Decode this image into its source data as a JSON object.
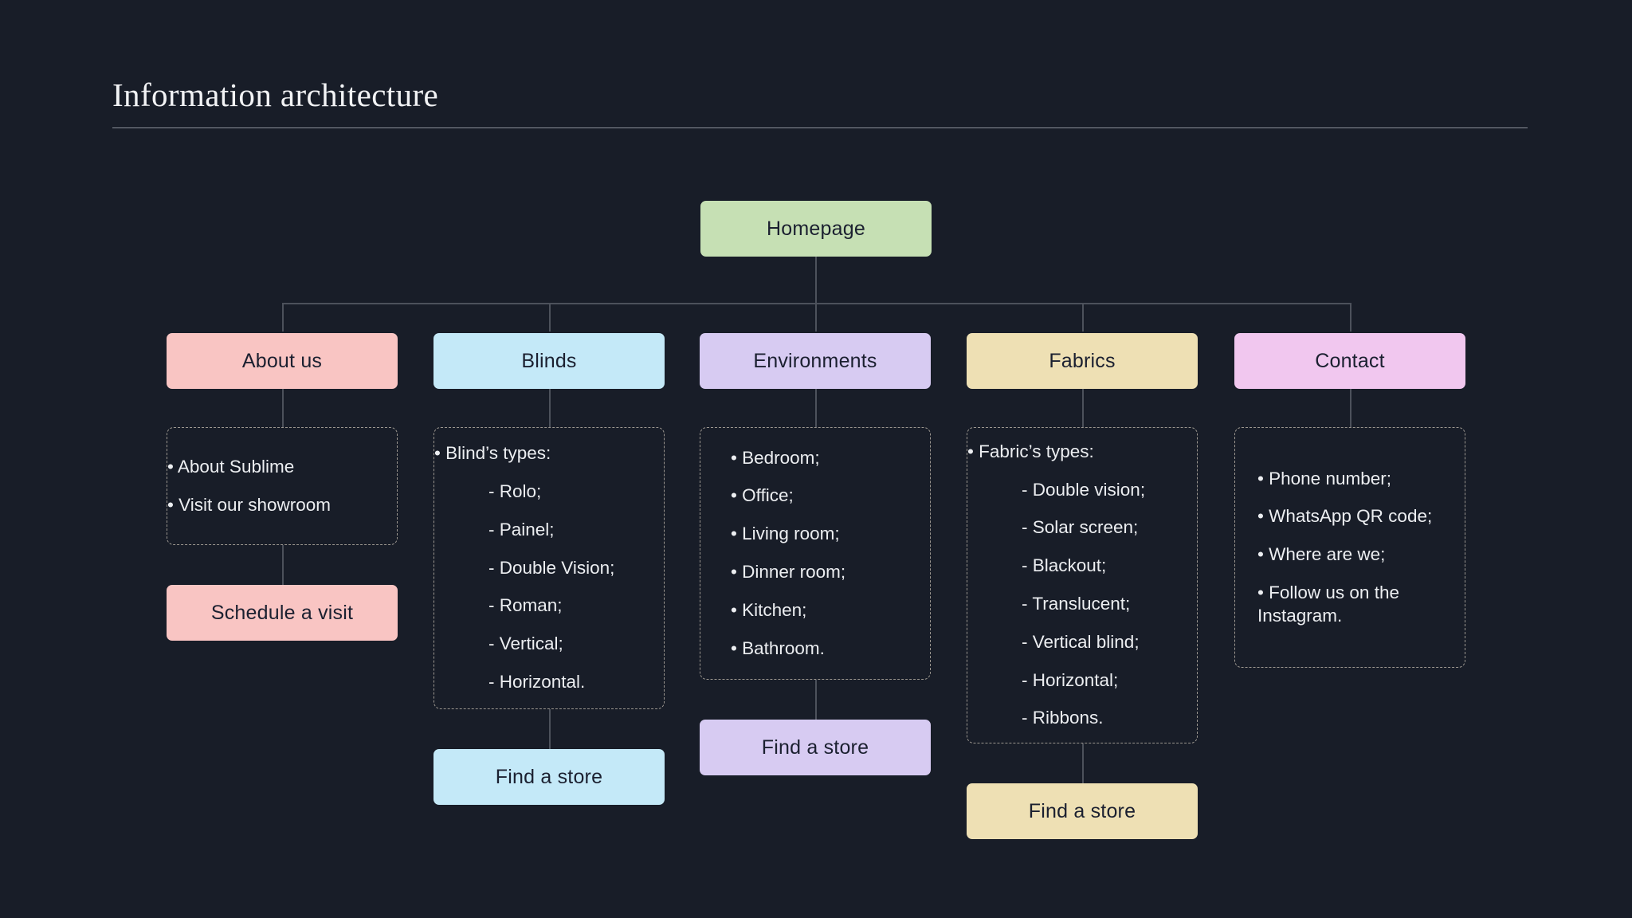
{
  "header": {
    "title": "Information architecture"
  },
  "colors": {
    "background": "#181d28",
    "connector": "#4c515b",
    "dashed_border": "#9b968f",
    "title_text": "#f2f3f5",
    "body_text": "#eceef1",
    "node_text": "#1b2030",
    "green": "#c6e0b4",
    "pink": "#f9c5c3",
    "blue": "#c4e9f8",
    "purple": "#d7cbf2",
    "tan": "#eee0b4",
    "magenta": "#f1c7ef"
  },
  "diagram": {
    "root": {
      "label": "Homepage",
      "color": "#c6e0b4"
    },
    "branches": [
      {
        "id": "about-us",
        "label": "About us",
        "color": "#f9c5c3",
        "details": [
          {
            "text": "• About Sublime",
            "level": 0
          },
          {
            "text": "• Visit our showroom",
            "level": 0
          }
        ],
        "cta": {
          "label": "Schedule a visit",
          "color": "#f9c5c3"
        }
      },
      {
        "id": "blinds",
        "label": "Blinds",
        "color": "#c4e9f8",
        "details": [
          {
            "text": "• Blind’s types:",
            "level": 0
          },
          {
            "text": "- Rolo;",
            "level": 1
          },
          {
            "text": "- Painel;",
            "level": 1
          },
          {
            "text": "- Double Vision;",
            "level": 1
          },
          {
            "text": "- Roman;",
            "level": 1
          },
          {
            "text": "- Vertical;",
            "level": 1
          },
          {
            "text": "- Horizontal.",
            "level": 1
          }
        ],
        "cta": {
          "label": "Find a store",
          "color": "#c4e9f8"
        }
      },
      {
        "id": "environments",
        "label": "Environments",
        "color": "#d7cbf2",
        "details": [
          {
            "text": "• Bedroom;",
            "level": 0
          },
          {
            "text": "• Office;",
            "level": 0
          },
          {
            "text": "• Living room;",
            "level": 0
          },
          {
            "text": "• Dinner room;",
            "level": 0
          },
          {
            "text": "• Kitchen;",
            "level": 0
          },
          {
            "text": "• Bathroom.",
            "level": 0
          }
        ],
        "cta": {
          "label": "Find a store",
          "color": "#d7cbf2"
        }
      },
      {
        "id": "fabrics",
        "label": "Fabrics",
        "color": "#eee0b4",
        "details": [
          {
            "text": "• Fabric’s types:",
            "level": 0
          },
          {
            "text": "- Double vision;",
            "level": 1
          },
          {
            "text": "- Solar screen;",
            "level": 1
          },
          {
            "text": "- Blackout;",
            "level": 1
          },
          {
            "text": "- Translucent;",
            "level": 1
          },
          {
            "text": "- Vertical blind;",
            "level": 1
          },
          {
            "text": "- Horizontal;",
            "level": 1
          },
          {
            "text": "- Ribbons.",
            "level": 1
          }
        ],
        "cta": {
          "label": "Find a store",
          "color": "#eee0b4"
        }
      },
      {
        "id": "contact",
        "label": "Contact",
        "color": "#f1c7ef",
        "details": [
          {
            "text": "• Phone number;",
            "level": 0
          },
          {
            "text": "• WhatsApp QR code;",
            "level": 0
          },
          {
            "text": "• Where are we;",
            "level": 0
          },
          {
            "text": "• Follow us on the Instagram.",
            "level": 0
          }
        ],
        "cta": null
      }
    ]
  }
}
